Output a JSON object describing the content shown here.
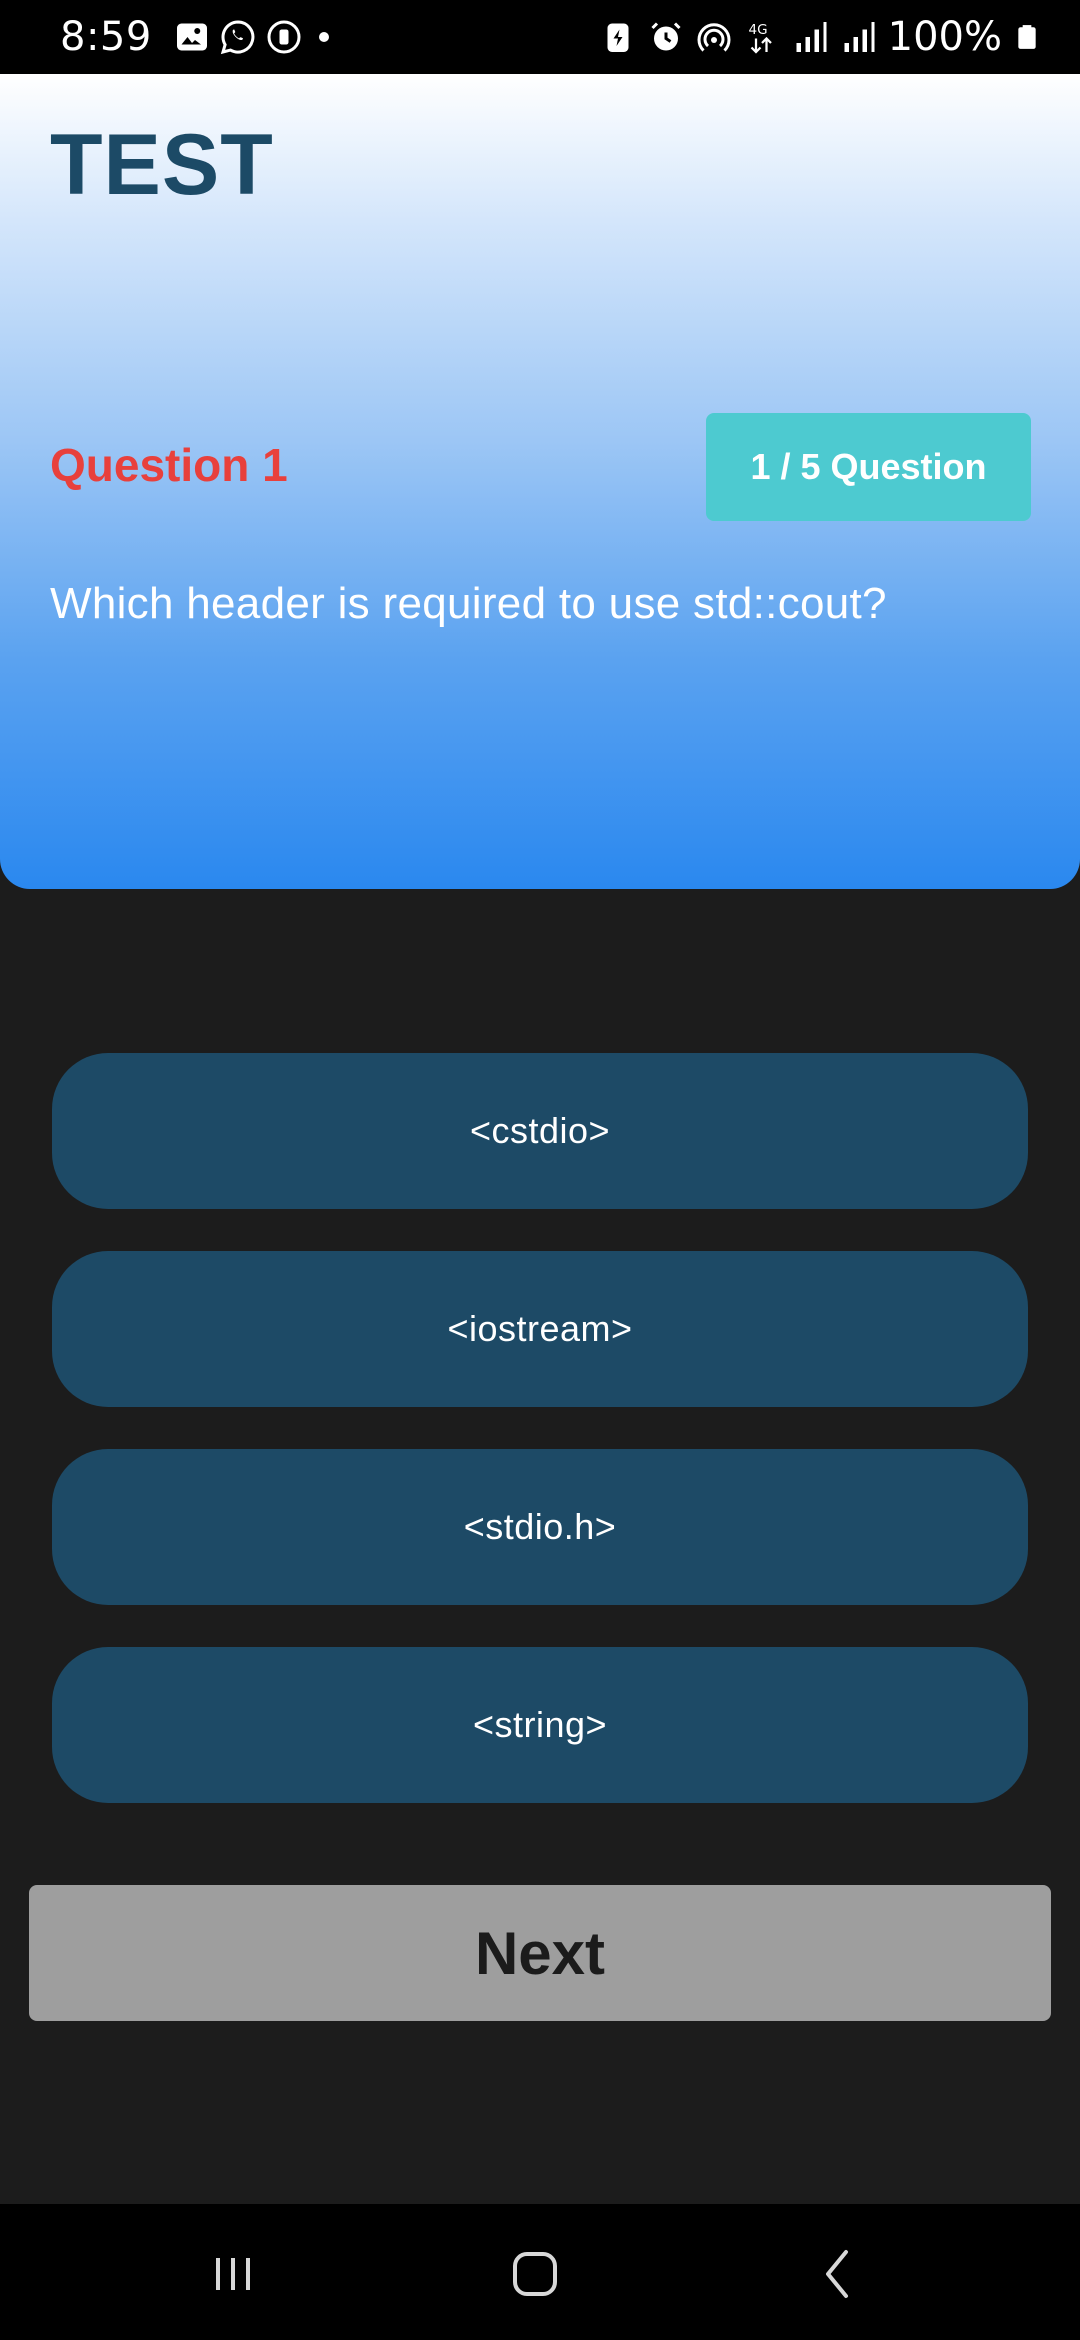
{
  "status_bar": {
    "time": "8:59",
    "battery_text": "100%",
    "left_icons": [
      "gallery-icon",
      "whatsapp-icon",
      "timer-icon",
      "dot-icon"
    ],
    "right_icons": [
      "battery-saver-icon",
      "alarm-icon",
      "hotspot-icon",
      "4g-icon",
      "signal-icon",
      "signal-icon",
      "battery-icon"
    ]
  },
  "header": {
    "title": "TEST",
    "question_label": "Question 1",
    "counter": "1 / 5 Question",
    "question_text": "Which header is required to use std::cout?"
  },
  "options": [
    {
      "label": "<cstdio>"
    },
    {
      "label": "<iostream>"
    },
    {
      "label": "<stdio.h>"
    },
    {
      "label": "<string>"
    }
  ],
  "next_button": {
    "label": "Next"
  },
  "nav_bar": {
    "icons": [
      "recents-icon",
      "home-icon",
      "back-icon"
    ]
  },
  "colors": {
    "title": "#1c4a66",
    "question_label": "#e8403c",
    "counter_bg": "#4dcad0",
    "option_bg": "#1d4a66",
    "next_bg": "#9e9e9e",
    "page_bg": "#1c1c1c",
    "header_gradient_end": "#2a88ef"
  }
}
